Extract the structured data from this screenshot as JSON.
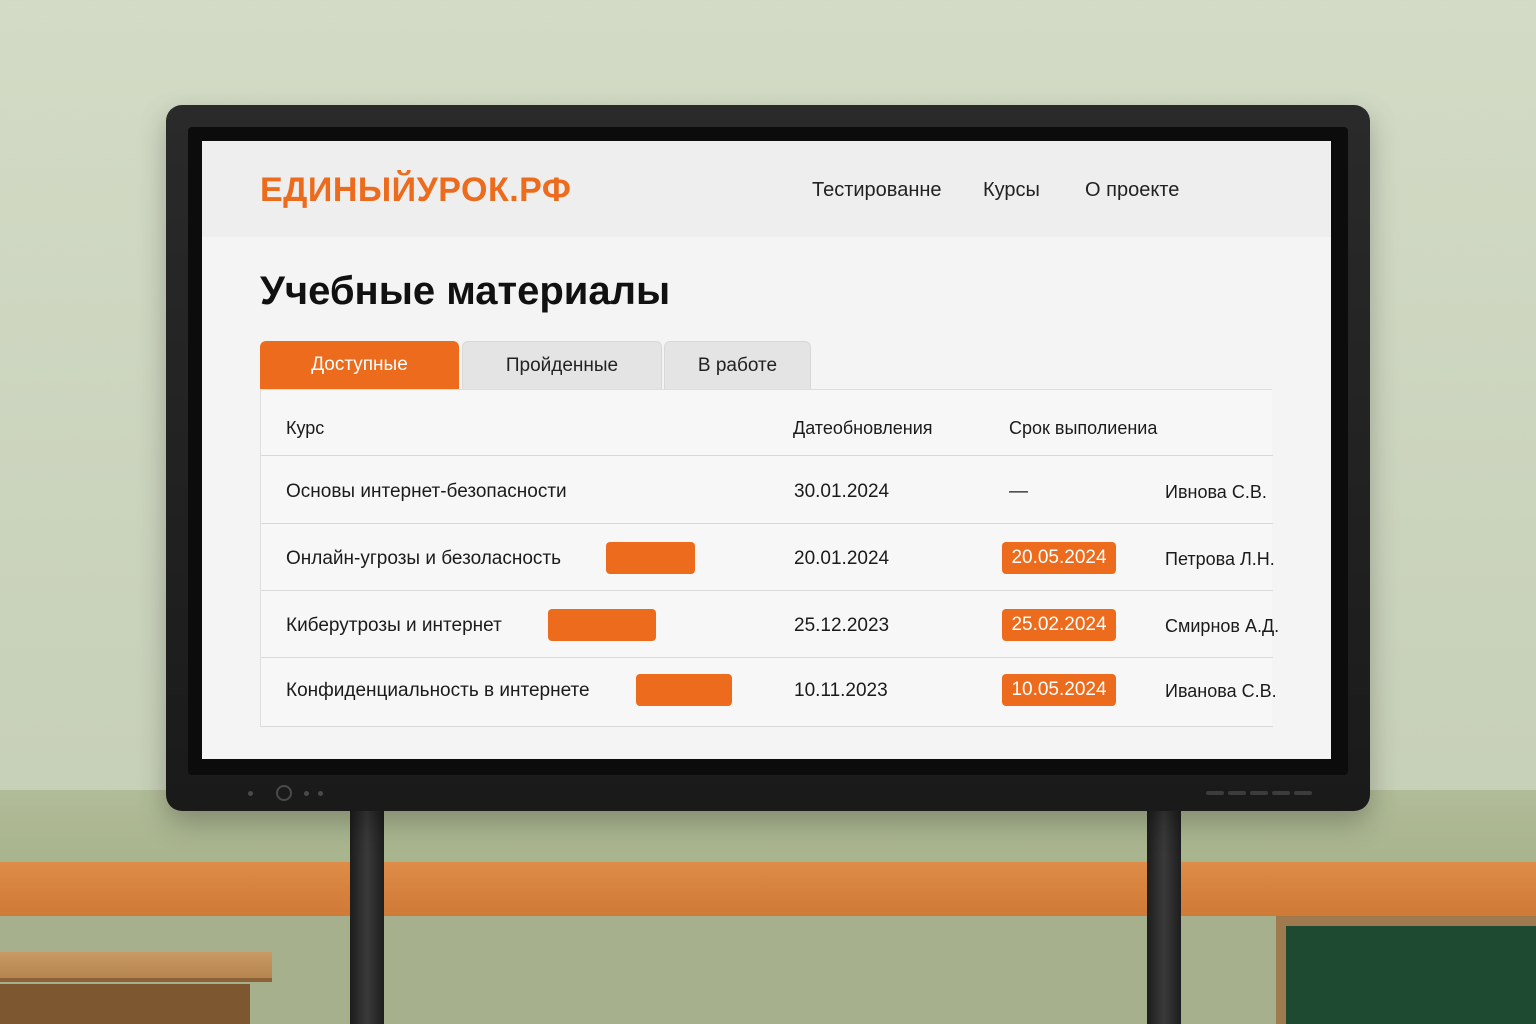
{
  "site": {
    "logo": "ЕДИНЫЙУРОК.РФ",
    "nav": [
      "Тестированне",
      "Курсы",
      "О проекте"
    ]
  },
  "page": {
    "title": "Учебные материалы"
  },
  "tabs": [
    {
      "label": "Доступные",
      "active": true
    },
    {
      "label": "Пройденные",
      "active": false
    },
    {
      "label": "В работе",
      "active": false
    }
  ],
  "table": {
    "columns": [
      "Курс",
      "Датеобновления",
      "Срок выполиениа"
    ],
    "rows": [
      {
        "course": "Основы интернет-безопасности",
        "updated": "30.01.2024",
        "deadline": "—",
        "author": "Ивнова С.В.",
        "deadline_highlight": false
      },
      {
        "course": "Онлайн-угрозы и безоласность",
        "updated": "20.01.2024",
        "deadline": "20.05.2024",
        "author": "Петрова Л.Н.",
        "deadline_highlight": true
      },
      {
        "course": "Киберутрозы и интернет",
        "updated": "25.12.2023",
        "deadline": "25.02.2024",
        "author": "Смирнов А.Д.",
        "deadline_highlight": true
      },
      {
        "course": "Конфиденциальность в интернете",
        "updated": "10.11.2023",
        "deadline": "10.05.2024",
        "author": "Иванова С.В.",
        "deadline_highlight": true
      }
    ]
  },
  "colors": {
    "accent": "#ec6b1c",
    "text": "#1b1b1b",
    "header_bg": "#eeeeee"
  }
}
